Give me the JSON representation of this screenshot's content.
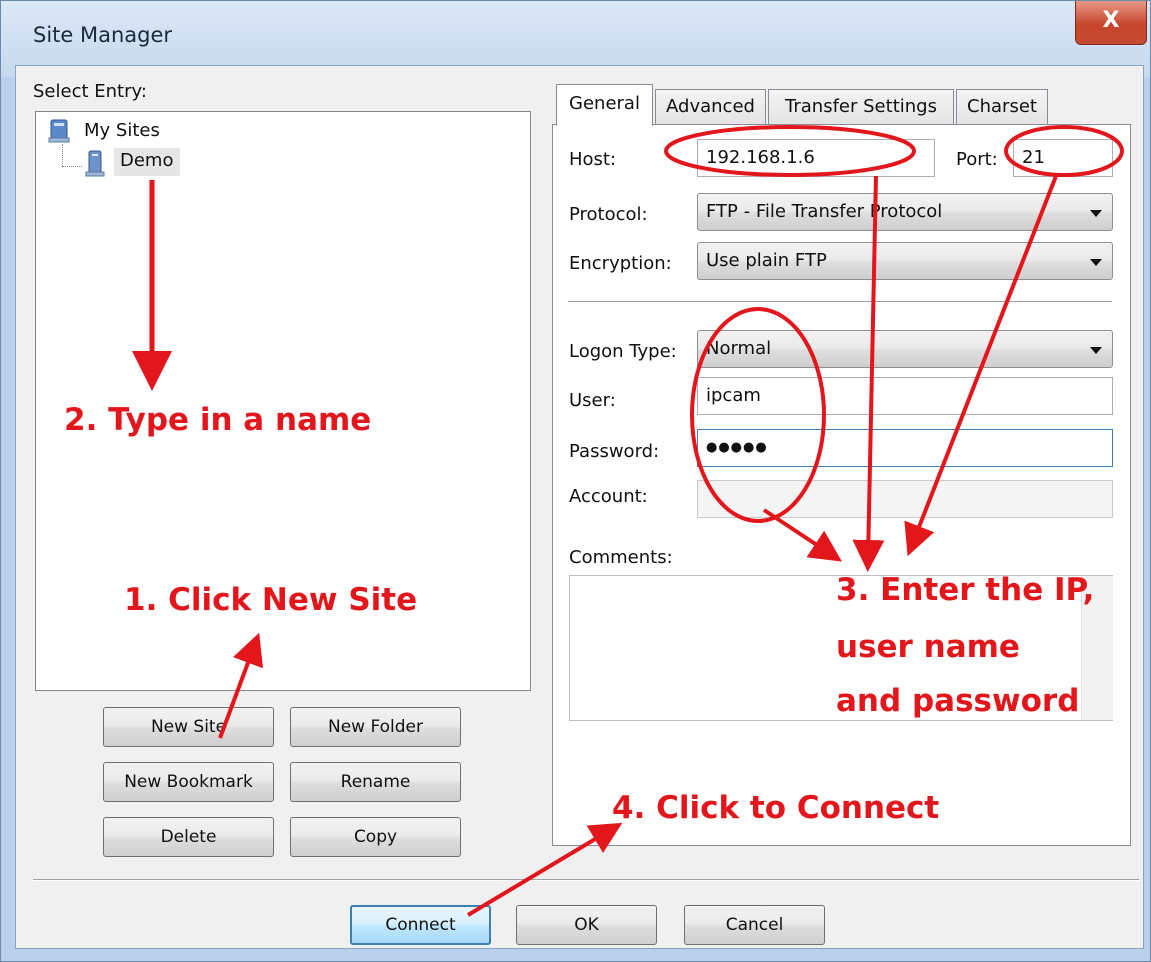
{
  "window": {
    "title": "Site Manager",
    "close_glyph": "X"
  },
  "left": {
    "select_entry_label": "Select Entry:",
    "tree": {
      "root_label": "My Sites",
      "child_label": "Demo"
    },
    "buttons": {
      "new_site": "New Site",
      "new_folder": "New Folder",
      "new_bookmark": "New Bookmark",
      "rename": "Rename",
      "delete": "Delete",
      "copy": "Copy"
    }
  },
  "tabs": [
    "General",
    "Advanced",
    "Transfer Settings",
    "Charset"
  ],
  "general": {
    "host_label": "Host:",
    "host_value": "192.168.1.6",
    "port_label": "Port:",
    "port_value": "21",
    "protocol_label": "Protocol:",
    "protocol_value": "FTP - File Transfer Protocol",
    "encryption_label": "Encryption:",
    "encryption_value": "Use plain FTP",
    "logon_type_label": "Logon Type:",
    "logon_type_value": "Normal",
    "user_label": "User:",
    "user_value": "ipcam",
    "password_label": "Password:",
    "password_value": "●●●●●",
    "account_label": "Account:",
    "account_value": "",
    "comments_label": "Comments:",
    "comments_value": ""
  },
  "footer": {
    "connect": "Connect",
    "ok": "OK",
    "cancel": "Cancel"
  },
  "annotations": {
    "step1": "1. Click New Site",
    "step2": "2. Type in a name",
    "step3_line1": "3. Enter the IP,",
    "step3_line2": "user name",
    "step3_line3": "and password",
    "step4": "4. Click to Connect"
  },
  "colors": {
    "annotation": "#e3161c",
    "title_bar": "#c6d9ee",
    "close_button": "#c7452b"
  },
  "icons": {
    "tree_root": "computer-folder-icon",
    "tree_child": "server-icon",
    "dropdown": "chevron-down-icon"
  }
}
